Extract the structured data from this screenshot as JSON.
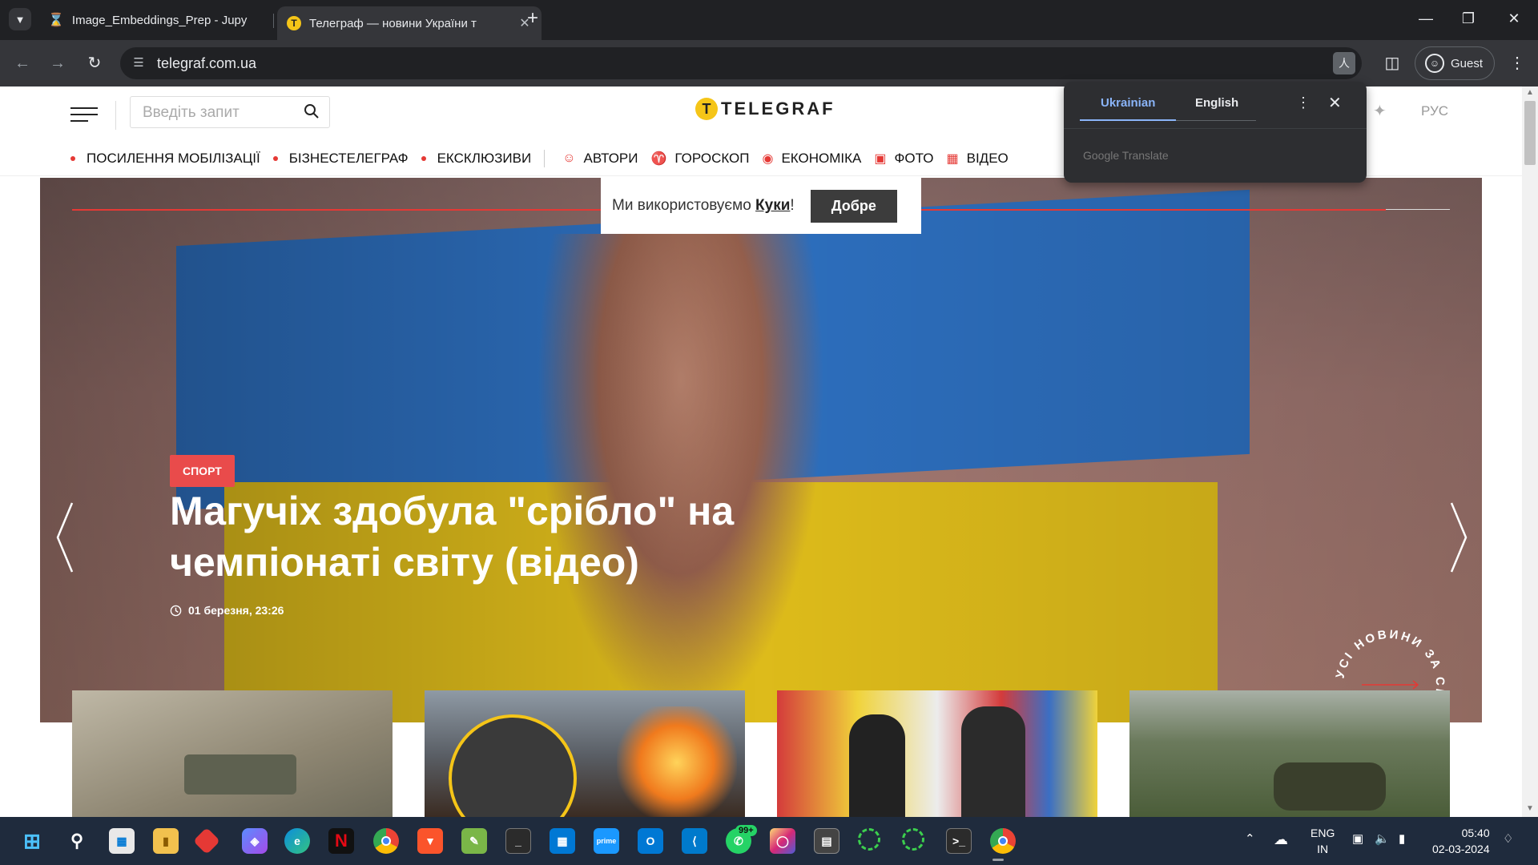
{
  "browser": {
    "tabs": [
      {
        "title": "Image_Embeddings_Prep - Jupy",
        "icon": "hourglass-icon",
        "active": false
      },
      {
        "title": "Телеграф — новини України т",
        "icon": "telegraf-favicon",
        "active": true
      }
    ],
    "new_tab": "+",
    "url": "telegraf.com.ua",
    "profile": "Guest"
  },
  "site": {
    "search_placeholder": "Введіть запит",
    "logo_text": "TELEGRAF",
    "lang_switch": "РУС",
    "nav": [
      {
        "label": "ПОСИЛЕННЯ МОБІЛІЗАЦІЇ",
        "kind": "dot"
      },
      {
        "label": "БІЗНЕСТЕЛЕГРАФ",
        "kind": "dot"
      },
      {
        "label": "ЕКСКЛЮЗИВИ",
        "kind": "dot"
      },
      {
        "label": "АВТОРИ",
        "kind": "icon",
        "icon": "user-circle-icon"
      },
      {
        "label": "ГОРОСКОП",
        "kind": "icon",
        "icon": "zodiac-icon"
      },
      {
        "label": "ЕКОНОМІКА",
        "kind": "icon",
        "icon": "coin-icon"
      },
      {
        "label": "ФОТО",
        "kind": "icon",
        "icon": "image-icon"
      },
      {
        "label": "ВІДЕО",
        "kind": "icon",
        "icon": "film-icon"
      }
    ],
    "hero": {
      "category": "СПОРТ",
      "headline": "Магучіх здобула \"срібло\" на чемпіонаті світу (відео)",
      "date": "01 березня, 23:26",
      "circle_text": "УСІ НОВИНИ ЗА СЬОГОДНІ"
    },
    "cookie": {
      "text": "Ми використовуємо ",
      "link": "Куки",
      "suffix": "!",
      "button": "Добре"
    }
  },
  "translate_popup": {
    "source": "Ukrainian",
    "target": "English",
    "brand": "Google Translate"
  },
  "taskbar": {
    "lang_top": "ENG",
    "lang_bottom": "IN",
    "time": "05:40",
    "date": "02-03-2024",
    "whatsapp_badge": "99+"
  }
}
